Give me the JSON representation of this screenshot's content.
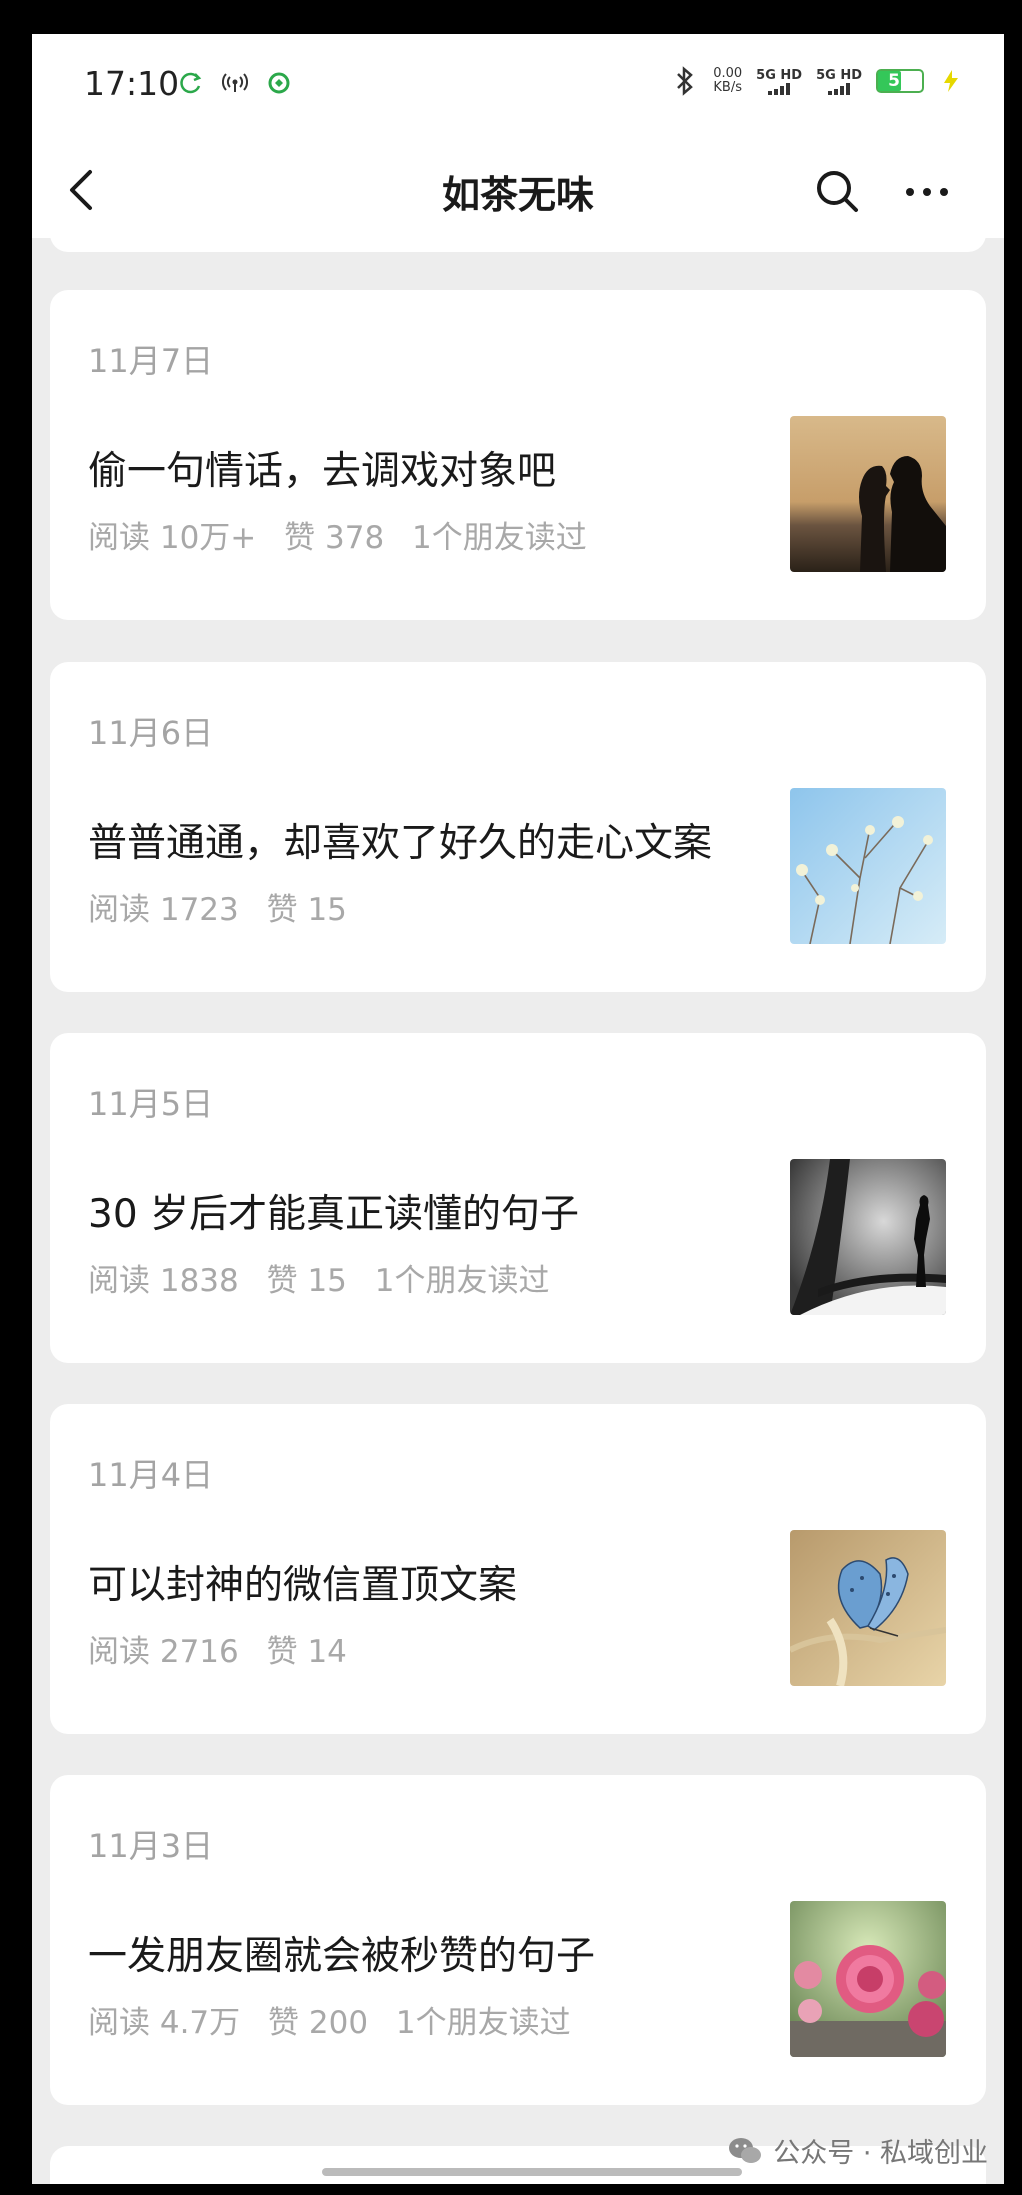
{
  "status_bar": {
    "time": "17:10",
    "net_speed_value": "0.00",
    "net_speed_unit": "KB/s",
    "signal1": "5G HD",
    "signal2": "5G HD",
    "battery": "53"
  },
  "nav": {
    "title": "如茶无味"
  },
  "articles": [
    {
      "date": "11月7日",
      "title": "偷一句情话，去调戏对象吧",
      "reads": "阅读 10万+",
      "likes": "赞 378",
      "friends": "1个朋友读过",
      "thumb": "couple-silhouette-sunset-image"
    },
    {
      "date": "11月6日",
      "title": "普普通通，却喜欢了好久的走心文案",
      "reads": "阅读 1723",
      "likes": "赞 15",
      "friends": "",
      "thumb": "blossom-branches-sky-image"
    },
    {
      "date": "11月5日",
      "title": "30 岁后才能真正读懂的句子",
      "reads": "阅读 1838",
      "likes": "赞 15",
      "friends": "1个朋友读过",
      "thumb": "woman-silhouette-light-image"
    },
    {
      "date": "11月4日",
      "title": "可以封神的微信置顶文案",
      "reads": "阅读 2716",
      "likes": "赞 14",
      "friends": "",
      "thumb": "blue-butterfly-image"
    },
    {
      "date": "11月3日",
      "title": "一发朋友圈就会被秒赞的句子",
      "reads": "阅读 4.7万",
      "likes": "赞 200",
      "friends": "1个朋友读过",
      "thumb": "pink-roses-image"
    }
  ],
  "watermark": "公众号 · 私域创业",
  "colors": {
    "background": "#ededed",
    "card": "#ffffff",
    "battery": "#34c759",
    "meta_text": "#a8a8a8"
  }
}
